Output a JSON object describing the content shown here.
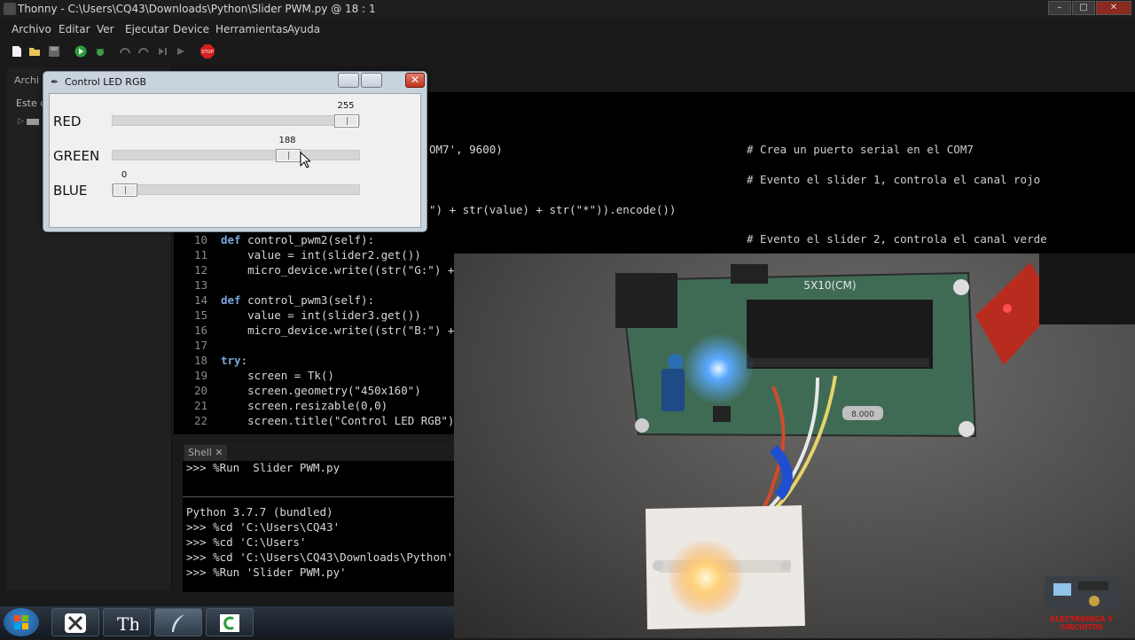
{
  "window": {
    "title": "Thonny  -  C:\\Users\\CQ43\\Downloads\\Python\\Slider PWM.py  @  18 : 1",
    "minimize_icon": "minimize-icon",
    "maximize_icon": "maximize-icon",
    "close_icon": "close-icon"
  },
  "menu": [
    "Archivo",
    "Editar",
    "Ver",
    "Ejecutar",
    "Device",
    "Herramientas",
    "Ayuda"
  ],
  "toolbar": {
    "icons": [
      "new-file-icon",
      "open-folder-icon",
      "save-icon",
      "run-icon",
      "debug-icon",
      "step-over-icon",
      "step-into-icon",
      "step-out-icon",
      "resume-icon",
      "stop-icon"
    ],
    "stop_label": "STOP"
  },
  "files_pane": {
    "tab": "Archi",
    "path": "Este c"
  },
  "editor": {
    "fragments": {
      "serial": "OM7', 9600)",
      "encode": "\") + str(value) + str(\"*\")).encode())"
    },
    "comments": [
      "# Crea un puerto serial en el COM7",
      "# Evento el slider 1, controla el canal rojo",
      "# Evento el slider 2, controla el canal verde"
    ],
    "line_numbers": [
      "10",
      "11",
      "12",
      "13",
      "14",
      "15",
      "16",
      "17",
      "18",
      "19",
      "20",
      "21",
      "22"
    ],
    "lines": [
      {
        "kw": "def",
        "rest": " control_pwm2(self):"
      },
      {
        "kw": "",
        "rest": "    value = int(slider2.get())"
      },
      {
        "kw": "",
        "rest": "    micro_device.write((str(\"G:\") +"
      },
      {
        "kw": "",
        "rest": ""
      },
      {
        "kw": "def",
        "rest": " control_pwm3(self):"
      },
      {
        "kw": "",
        "rest": "    value = int(slider3.get())"
      },
      {
        "kw": "",
        "rest": "    micro_device.write((str(\"B:\") +"
      },
      {
        "kw": "",
        "rest": ""
      },
      {
        "kw": "try",
        "rest": ":"
      },
      {
        "kw": "",
        "rest": "    screen = Tk()"
      },
      {
        "kw": "",
        "rest": "    screen.geometry(\"450x160\")"
      },
      {
        "kw": "",
        "rest": "    screen.resizable(0,0)"
      },
      {
        "kw": "",
        "rest": "    screen.title(\"Control LED RGB\")"
      }
    ]
  },
  "shell": {
    "tab": "Shell",
    "close_icon": "tab-close-icon",
    "lines": [
      ">>> %Run  Slider PWM.py",
      "",
      "Python 3.7.7 (bundled)",
      ">>> %cd 'C:\\Users\\CQ43'",
      ">>> %cd 'C:\\Users'",
      ">>> %cd 'C:\\Users\\CQ43\\Downloads\\Python'",
      ">>> %Run 'Slider PWM.py'"
    ]
  },
  "dialog": {
    "title": "Control LED RGB",
    "sliders": [
      {
        "label": "RED",
        "value": "255",
        "fraction": 1.0
      },
      {
        "label": "GREEN",
        "value": "188",
        "fraction": 0.737
      },
      {
        "label": "BLUE",
        "value": "0",
        "fraction": 0.0
      }
    ]
  },
  "photo": {
    "board_label": "5X10(CM)",
    "crystal_label": "8.000"
  },
  "taskbar": {
    "icons": [
      "windows-start-icon",
      "xampp-icon",
      "thonny-icon",
      "feather-icon",
      "code-editor-icon"
    ]
  },
  "logo": {
    "text": "ELECTRONICA Y CIRCUITOS"
  },
  "colors": {
    "led_blue": "#5aa8ff",
    "led_rgb": "#ffd27a",
    "pcb": "#3f6b55"
  }
}
